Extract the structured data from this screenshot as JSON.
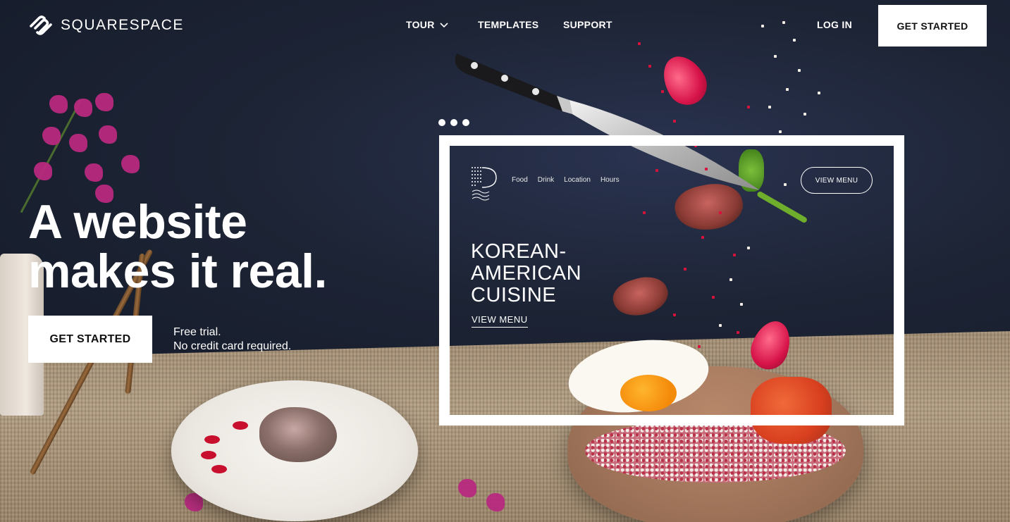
{
  "brand": {
    "name": "SQUARESPACE",
    "accent": "#ffffff",
    "background": "#1b2233"
  },
  "nav": {
    "items": [
      {
        "label": "TOUR",
        "icon": "chevron-down-icon"
      },
      {
        "label": "TEMPLATES"
      },
      {
        "label": "SUPPORT"
      }
    ],
    "login": "LOG IN",
    "cta": "GET STARTED"
  },
  "hero": {
    "headline_line1": "A website",
    "headline_line2": "makes it real.",
    "cta": "GET STARTED",
    "note_line1": "Free trial.",
    "note_line2": "No credit card required."
  },
  "mockup": {
    "nav": [
      "Food",
      "Drink",
      "Location",
      "Hours"
    ],
    "pill": "VIEW MENU",
    "title_line1": "KOREAN-",
    "title_line2": "AMERICAN",
    "title_line3": "CUISINE",
    "link": "VIEW MENU"
  }
}
